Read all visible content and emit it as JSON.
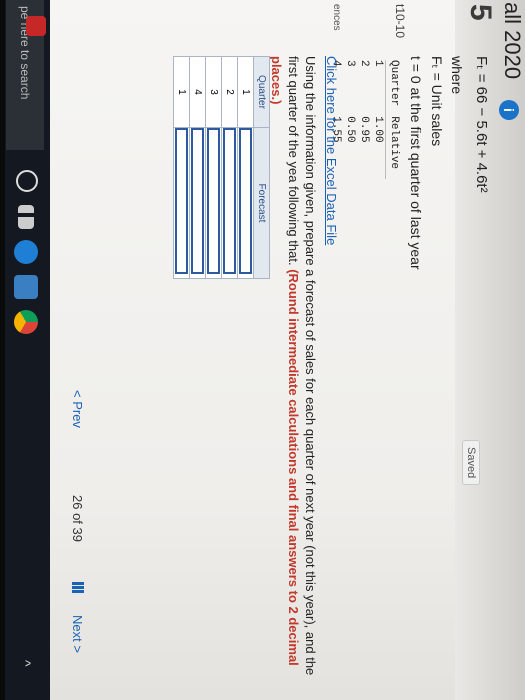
{
  "header": {
    "course_title": "all 2020",
    "info_icon": "i",
    "question_number": "5",
    "saved_label": "Saved"
  },
  "sidebar": {
    "label_1": "t10-10",
    "label_2": "ences"
  },
  "question": {
    "formula": "Fₜ = 66 − 5.6t + 4.6t²",
    "where": "where",
    "def_1": "Fₜ = Unit sales",
    "def_2": "t = 0 at the first quarter of last year",
    "relative_table": {
      "headers": [
        "Quarter",
        "Relative"
      ],
      "rows": [
        [
          "1",
          "1.00"
        ],
        [
          "2",
          "0.95"
        ],
        [
          "3",
          "0.50"
        ],
        [
          "4",
          "1.55"
        ]
      ]
    },
    "excel_link": "Click here for the Excel Data File",
    "instruction_plain": "Using the information given, prepare a forecast of sales for each quarter of next year (not this year), and the first quarter of the yea following that.",
    "instruction_bold": "(Round intermediate calculations and final answers to 2 decimal places.)"
  },
  "forecast_table": {
    "headers": [
      "Quarter",
      "Forecast"
    ],
    "rows": [
      "1",
      "2",
      "3",
      "4",
      "1"
    ]
  },
  "navigation": {
    "prev_label": "< Prev",
    "page_counter": "26 of 39",
    "next_label": "Next >"
  },
  "taskbar": {
    "search_placeholder": "pe here to search"
  }
}
